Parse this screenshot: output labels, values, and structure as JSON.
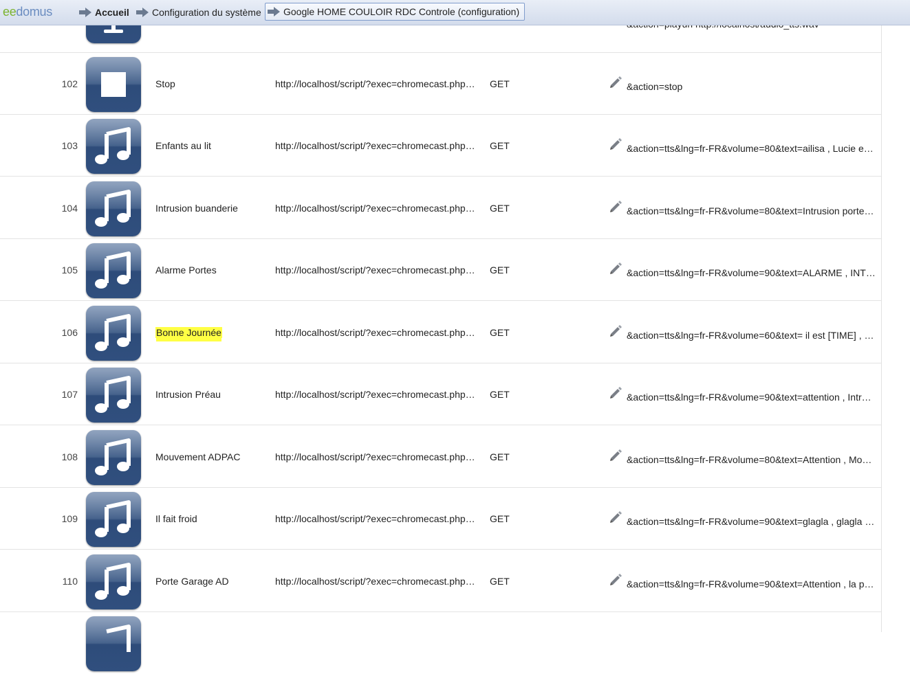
{
  "app": {
    "logo_part1": "ee",
    "logo_part2": "domus"
  },
  "breadcrumb": [
    {
      "label": "Accueil"
    },
    {
      "label": "Configuration du système"
    },
    {
      "label": "Google HOME COULOIR RDC Controle (configuration)"
    }
  ],
  "partial_top": {
    "param": "&action=playurl http://localhost/audio_tts.wav"
  },
  "rows": [
    {
      "num": "102",
      "name": "Stop",
      "url": "http://localhost/script/?exec=chromecast.php&i…",
      "method": "GET",
      "param": "&action=stop",
      "icon": "stop-icon"
    },
    {
      "num": "103",
      "name": "Enfants au lit",
      "url": "http://localhost/script/?exec=chromecast.php&i…",
      "method": "GET",
      "param": "&action=tts&lng=fr-FR&volume=80&text=ailisa , Lucie et …",
      "icon": "music-note-icon"
    },
    {
      "num": "104",
      "name": "Intrusion buanderie",
      "url": "http://localhost/script/?exec=chromecast.php&i…",
      "method": "GET",
      "param": "&action=tts&lng=fr-FR&volume=80&text=Intrusion porte …",
      "icon": "music-note-icon"
    },
    {
      "num": "105",
      "name": "Alarme Portes",
      "url": "http://localhost/script/?exec=chromecast.php&i…",
      "method": "GET",
      "param": "&action=tts&lng=fr-FR&volume=90&text=ALARME , INT…",
      "icon": "music-note-icon"
    },
    {
      "num": "106",
      "name": "Bonne Journée",
      "url": "http://localhost/script/?exec=chromecast.php&i…",
      "method": "GET",
      "param": "&action=tts&lng=fr-FR&volume=60&text= il est [TIME] , d…",
      "icon": "music-note-icon",
      "highlight_color": "#ffff44"
    },
    {
      "num": "107",
      "name": "Intrusion Préau",
      "url": "http://localhost/script/?exec=chromecast.php&i…",
      "method": "GET",
      "param": "&action=tts&lng=fr-FR&volume=90&text=attention , Intru…",
      "icon": "music-note-icon"
    },
    {
      "num": "108",
      "name": "Mouvement ADPAC",
      "url": "http://localhost/script/?exec=chromecast.php&i…",
      "method": "GET",
      "param": "&action=tts&lng=fr-FR&volume=80&text=Attention , Mou…",
      "icon": "music-note-icon"
    },
    {
      "num": "109",
      "name": "Il fait froid",
      "url": "http://localhost/script/?exec=chromecast.php&i…",
      "method": "GET",
      "param": "&action=tts&lng=fr-FR&volume=90&text=glagla , glagla , …",
      "icon": "music-note-icon"
    },
    {
      "num": "110",
      "name": "Porte Garage AD",
      "url": "http://localhost/script/?exec=chromecast.php&i…",
      "method": "GET",
      "param": "&action=tts&lng=fr-FR&volume=90&text=Attention , la po…",
      "icon": "music-note-icon"
    }
  ],
  "colors": {
    "topbar": "#dbe3f1",
    "icon_bg": "#3c5a86",
    "highlight": "#ffff44",
    "logo_green": "#7bb32e",
    "logo_blue": "#6a8cc0"
  }
}
